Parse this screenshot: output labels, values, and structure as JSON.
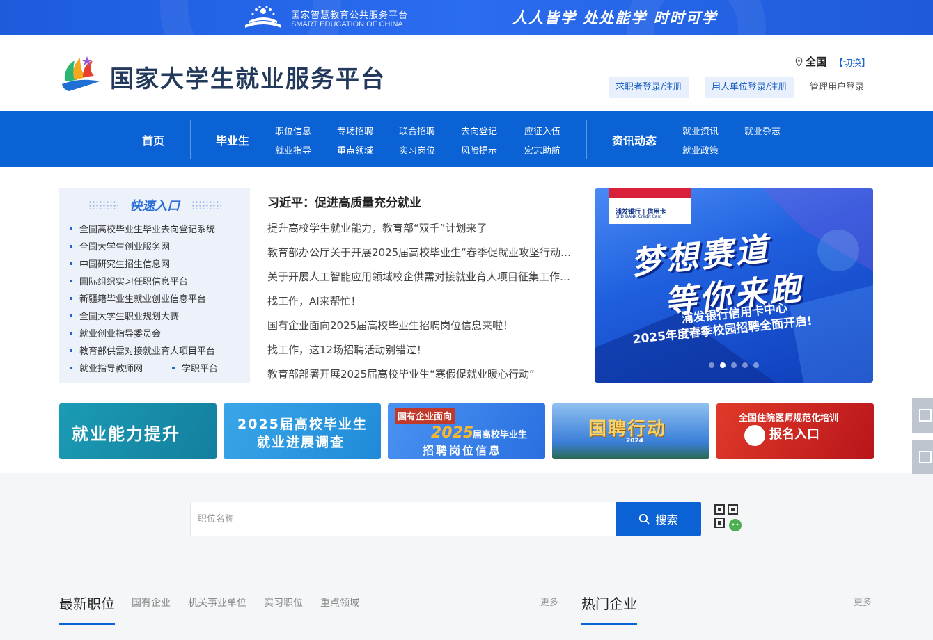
{
  "topbar": {
    "platform_cn": "国家智慧教育公共服务平台",
    "platform_en": "SMART EDUCATION OF CHINA",
    "slogan": "人人皆学 处处能学 时时可学"
  },
  "header": {
    "site_name": "国家大学生就业服务平台",
    "region": "全国",
    "switch": "【切换】",
    "jobseeker_login": "求职者登录/注册",
    "employer_login": "用人单位登录/注册",
    "admin_login": "管理用户登录"
  },
  "nav": {
    "home": "首页",
    "graduates": "毕业生",
    "grad_links": [
      "职位信息",
      "专场招聘",
      "联合招聘",
      "去向登记",
      "应征入伍",
      "就业指导",
      "重点领域",
      "实习岗位",
      "风险提示",
      "宏志助航"
    ],
    "news": "资讯动态",
    "news_links": [
      "就业资讯",
      "就业杂志",
      "就业政策"
    ]
  },
  "quick": {
    "title": "快速入口",
    "items": [
      "全国高校毕业生毕业去向登记系统",
      "全国大学生创业服务网",
      "中国研究生招生信息网",
      "国际组织实习任职信息平台",
      "新疆籍毕业生就业创业信息平台",
      "全国大学生职业规划大赛",
      "就业创业指导委员会",
      "教育部供需对接就业育人项目平台",
      "就业指导教师网",
      "学职平台"
    ]
  },
  "news": {
    "headline": "习近平：促进高质量充分就业",
    "items": [
      "提升高校学生就业能力，教育部“双千”计划来了",
      "教育部办公厅关于开展2025届高校毕业生“春季促就业攻坚行动”的通知",
      "关于开展人工智能应用领域校企供需对接就业育人项目征集工作的通知",
      "找工作，AI来帮忙！",
      "国有企业面向2025届高校毕业生招聘岗位信息来啦！",
      "找工作，这12场招聘活动别错过！",
      "教育部部署开展2025届高校毕业生“寒假促就业暖心行动”"
    ]
  },
  "carousel": {
    "brand": "浦发银行 | 信用卡",
    "brand_en": "SPD BANK  Credit Card",
    "line1": "梦想赛道",
    "line2": "等你来跑",
    "sub1": "浦发银行信用卡中心",
    "sub2": "2025年度春季校园招聘全面开启!",
    "slide_count": 5,
    "active_slide": 1
  },
  "banners": [
    {
      "text": "就业能力提升",
      "color": "#1a8fb0"
    },
    {
      "text": "2025届高校毕业生",
      "text2": "就业进展调查",
      "color": "#2a9ee0"
    },
    {
      "text": "国有企业面向",
      "text2": "届高校毕业生",
      "text3": "招聘岗位信息",
      "year": "2025",
      "color": "#2f7ee8"
    },
    {
      "text": "国聘行动",
      "text2": "2024",
      "color": "#3a7ed8"
    },
    {
      "text": "全国住院医师规范化培训",
      "text2": "报名入口",
      "color": "#d3231f"
    }
  ],
  "search": {
    "placeholder": "职位名称",
    "button": "搜索"
  },
  "lower": {
    "latest_jobs": "最新职位",
    "tabs": [
      "国有企业",
      "机关事业单位",
      "实习职位",
      "重点领域"
    ],
    "more": "更多",
    "hot_companies": "热门企业"
  }
}
